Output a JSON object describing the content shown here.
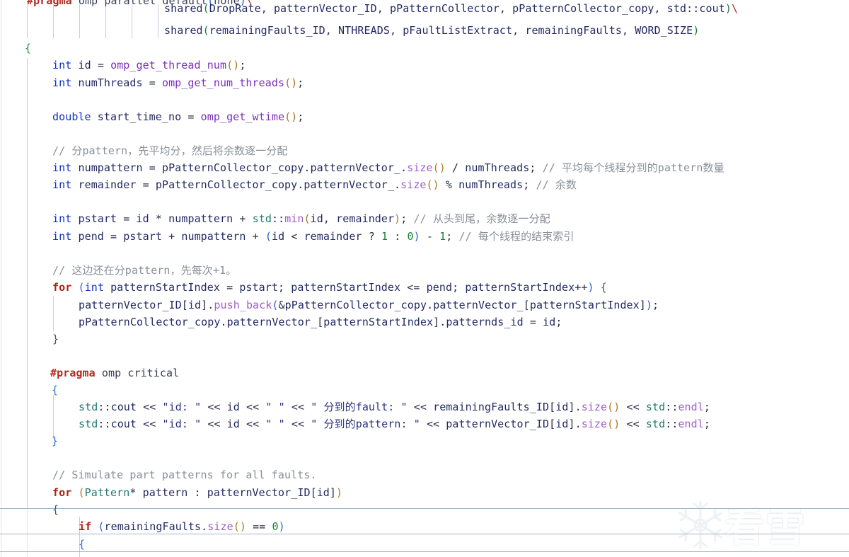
{
  "editor": {
    "language": "C++",
    "background": "#ffffff",
    "watermark": {
      "text": "看雪",
      "logo": "snowflake-icon"
    },
    "colors": {
      "keyword": "#0d34c8",
      "control": "#b02010",
      "preprocessor": "#b5281e",
      "comment": "#8a8f99",
      "string": "#2b3180",
      "function": "#7a2fbf",
      "member": "#a05ec9",
      "number": "#1a7f37",
      "identifier": "#232a63",
      "highlight_rule": "#9fb6c6",
      "indent_guide": "#c6cfd8",
      "gutter_rail": "#dfe5ea"
    },
    "current_statement_line": "if (remainingFaults.size() == 0)"
  },
  "code": {
    "lines": [
      "#pragma omp parallel default(none)\\",
      "                    shared(DropRate, patternVector_ID, pPatternCollector, pPatternCollector_copy, std::cout)\\",
      "                    shared(remainingFaults_ID, NTHREADS, pFaultListExtract, remainingFaults, WORD_SIZE)",
      "{",
      "    int id = omp_get_thread_num();",
      "    int numThreads = omp_get_num_threads();",
      "",
      "    double start_time_no = omp_get_wtime();",
      "",
      "    // 分pattern，先平均分，然后将余数逐一分配",
      "    int numpattern = pPatternCollector_copy.patternVector_.size() / numThreads; // 平均每个线程分到的pattern数量",
      "    int remainder = pPatternCollector_copy.patternVector_.size() % numThreads; // 余数",
      "",
      "    int pstart = id * numpattern + std::min(id, remainder); // 从头到尾，余数逐一分配",
      "    int pend = pstart + numpattern + (id < remainder ? 1 : 0) - 1; // 每个线程的结束索引",
      "",
      "    // 这边还在分pattern，先每次+1。",
      "    for (int patternStartIndex = pstart; patternStartIndex <= pend; patternStartIndex++) {",
      "        patternVector_ID[id].push_back(&pPatternCollector_copy.patternVector_[patternStartIndex]);",
      "        pPatternCollector_copy.patternVector_[patternStartIndex].patternds_id = id;",
      "    }",
      "",
      "",
      "    #pragma omp critical",
      "    {",
      "        std::cout << \"id: \" << id << \" \" << \" 分到的fault: \" << remainingFaults_ID[id].size() << std::endl;",
      "        std::cout << \"id: \" << id << \" \" << \" 分到的pattern: \" << patternVector_ID[id].size() << std::endl;",
      "    }",
      "",
      "",
      "    // Simulate part patterns for all faults.",
      "    for (Pattern* pattern : patternVector_ID[id])",
      "    {",
      "        if (remainingFaults.size() == 0)",
      "        {"
    ]
  }
}
